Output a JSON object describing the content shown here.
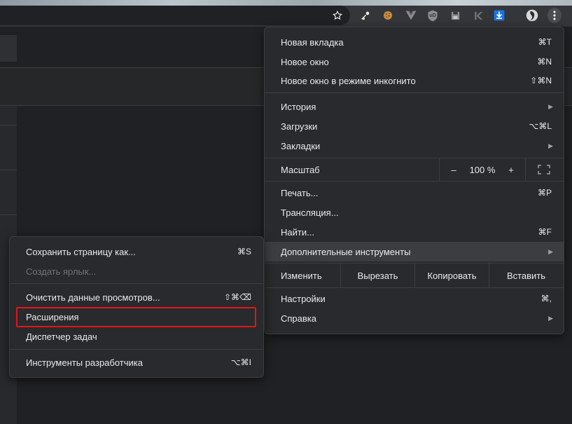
{
  "toolbar": {
    "icons": [
      "star-icon",
      "eyedropper-icon",
      "cookie-icon",
      "vue-devtools-icon",
      "ublock-icon",
      "save-icon",
      "k-extension-icon",
      "download-icon",
      "avatar",
      "more-vert-icon"
    ],
    "ublock_badge": "uD"
  },
  "main_menu": {
    "new_tab": {
      "label": "Новая вкладка",
      "shortcut": "⌘T"
    },
    "new_window": {
      "label": "Новое окно",
      "shortcut": "⌘N"
    },
    "incognito": {
      "label": "Новое окно в режиме инкогнито",
      "shortcut": "⇧⌘N"
    },
    "history": {
      "label": "История"
    },
    "downloads": {
      "label": "Загрузки",
      "shortcut": "⌥⌘L"
    },
    "bookmarks": {
      "label": "Закладки"
    },
    "zoom": {
      "label": "Масштаб",
      "minus": "–",
      "value": "100 %",
      "plus": "+"
    },
    "print": {
      "label": "Печать...",
      "shortcut": "⌘P"
    },
    "cast": {
      "label": "Трансляция..."
    },
    "find": {
      "label": "Найти...",
      "shortcut": "⌘F"
    },
    "more_tools": {
      "label": "Дополнительные инструменты"
    },
    "edit": {
      "label": "Изменить",
      "cut": "Вырезать",
      "copy": "Копировать",
      "paste": "Вставить"
    },
    "settings": {
      "label": "Настройки",
      "shortcut": "⌘,"
    },
    "help": {
      "label": "Справка"
    }
  },
  "submenu": {
    "save_page": {
      "label": "Сохранить страницу как...",
      "shortcut": "⌘S"
    },
    "create_shortcut": {
      "label": "Создать ярлык..."
    },
    "clear_data": {
      "label": "Очистить данные просмотров...",
      "shortcut": "⇧⌘⌫"
    },
    "extensions": {
      "label": "Расширения"
    },
    "task_manager": {
      "label": "Диспетчер задач"
    },
    "devtools": {
      "label": "Инструменты разработчика",
      "shortcut": "⌥⌘I"
    }
  },
  "colors": {
    "highlight_box": "#e0161a",
    "menu_bg": "#292a2d"
  }
}
